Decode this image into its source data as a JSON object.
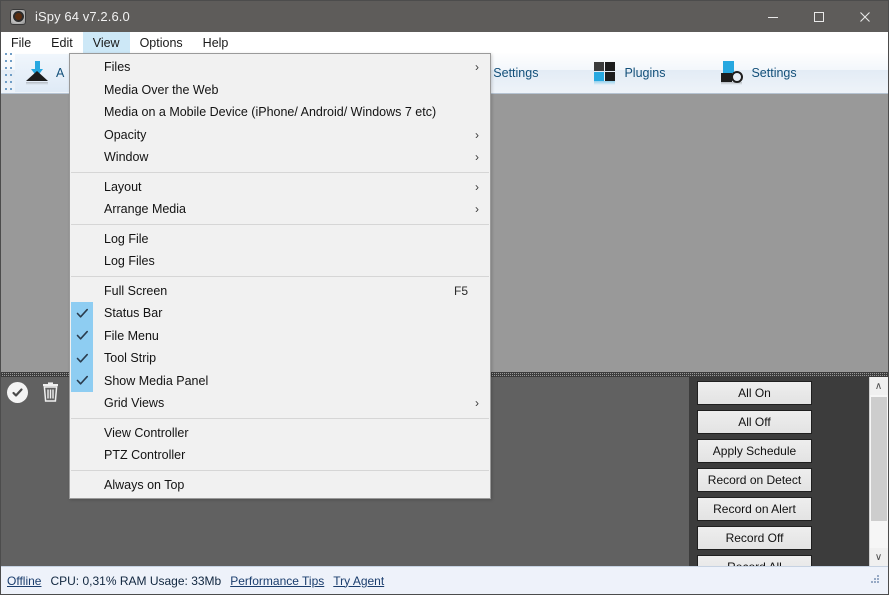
{
  "window": {
    "title": "iSpy 64 v7.2.6.0",
    "icon": "eye-icon",
    "minimize_label": "—",
    "maximize_label": "□",
    "close_label": "✕"
  },
  "menubar": {
    "items": [
      {
        "label": "File",
        "active": false
      },
      {
        "label": "Edit",
        "active": false
      },
      {
        "label": "View",
        "active": true
      },
      {
        "label": "Options",
        "active": false
      },
      {
        "label": "Help",
        "active": false
      }
    ]
  },
  "toolbar": {
    "buttons": [
      {
        "label": "A",
        "icon": "add-icon"
      },
      {
        "label": "Web Settings",
        "icon": "web-settings-icon"
      },
      {
        "label": "Plugins",
        "icon": "plugins-icon"
      },
      {
        "label": "Settings",
        "icon": "settings-icon"
      }
    ]
  },
  "view_menu": {
    "items": [
      {
        "label": "Files",
        "checked": false,
        "submenu": true,
        "shortcut": ""
      },
      {
        "label": "Media Over the Web",
        "checked": false,
        "submenu": false,
        "shortcut": ""
      },
      {
        "label": "Media on a Mobile Device (iPhone/ Android/ Windows 7 etc)",
        "checked": false,
        "submenu": false,
        "shortcut": ""
      },
      {
        "label": "Opacity",
        "checked": false,
        "submenu": true,
        "shortcut": ""
      },
      {
        "label": "Window",
        "checked": false,
        "submenu": true,
        "shortcut": ""
      },
      {
        "separator": true
      },
      {
        "label": "Layout",
        "checked": false,
        "submenu": true,
        "shortcut": ""
      },
      {
        "label": "Arrange Media",
        "checked": false,
        "submenu": true,
        "shortcut": ""
      },
      {
        "separator": true
      },
      {
        "label": "Log File",
        "checked": false,
        "submenu": false,
        "shortcut": ""
      },
      {
        "label": "Log Files",
        "checked": false,
        "submenu": false,
        "shortcut": ""
      },
      {
        "separator": true
      },
      {
        "label": "Full Screen",
        "checked": false,
        "submenu": false,
        "shortcut": "F5"
      },
      {
        "label": "Status Bar",
        "checked": true,
        "submenu": false,
        "shortcut": ""
      },
      {
        "label": "File Menu",
        "checked": true,
        "submenu": false,
        "shortcut": ""
      },
      {
        "label": "Tool Strip",
        "checked": true,
        "submenu": false,
        "shortcut": ""
      },
      {
        "label": "Show Media Panel",
        "checked": true,
        "submenu": false,
        "shortcut": ""
      },
      {
        "label": "Grid Views",
        "checked": false,
        "submenu": true,
        "shortcut": ""
      },
      {
        "separator": true
      },
      {
        "label": "View Controller",
        "checked": false,
        "submenu": false,
        "shortcut": ""
      },
      {
        "label": "PTZ Controller",
        "checked": false,
        "submenu": false,
        "shortcut": ""
      },
      {
        "separator": true
      },
      {
        "label": "Always on Top",
        "checked": false,
        "submenu": false,
        "shortcut": ""
      }
    ]
  },
  "media_panel": {
    "icons": [
      {
        "name": "confirm-icon"
      },
      {
        "name": "delete-icon"
      }
    ]
  },
  "control_panel": {
    "buttons": [
      "All On",
      "All Off",
      "Apply Schedule",
      "Record on Detect",
      "Record on Alert",
      "Record Off",
      "Record All"
    ],
    "scrollbar": {
      "up": "∧",
      "down": "∨"
    }
  },
  "statusbar": {
    "connection": "Offline",
    "cpu_ram": "CPU: 0,31% RAM Usage: 33Mb",
    "performance_tips": "Performance Tips",
    "try_agent": "Try Agent"
  },
  "colors": {
    "titlebar": "#5e5c5a",
    "accent": "#27a8e0",
    "menu_highlight": "#cde8f7",
    "check_highlight": "#8ecdf2",
    "canvas_top": "#999999",
    "canvas_bottom": "#616161",
    "panel_bg": "#3c3c3c",
    "statusbar": "#eef2fa"
  }
}
